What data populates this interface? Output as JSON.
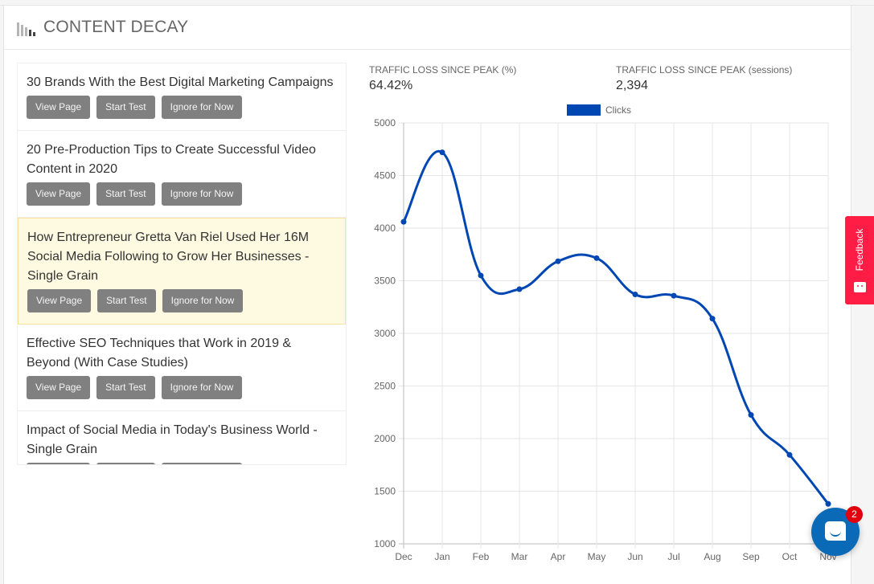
{
  "panel": {
    "title": "CONTENT DECAY",
    "icon": "bar-chart-decreasing-icon"
  },
  "list": {
    "items": [
      {
        "title": "30 Brands With the Best Digital Marketing Campaigns",
        "highlighted": false
      },
      {
        "title": "20 Pre-Production Tips to Create Successful Video Content in 2020",
        "highlighted": false
      },
      {
        "title": "How Entrepreneur Gretta Van Riel Used Her 16M Social Media Following to Grow Her Businesses - Single Grain",
        "highlighted": true
      },
      {
        "title": "Effective SEO Techniques that Work in 2019 & Beyond (With Case Studies)",
        "highlighted": false
      },
      {
        "title": "Impact of Social Media in Today's Business World - Single Grain",
        "highlighted": false
      }
    ],
    "buttons": {
      "view": "View Page",
      "test": "Start Test",
      "ignore": "Ignore for Now"
    }
  },
  "stats": {
    "loss_pct_label": "TRAFFIC LOSS SINCE PEAK (%)",
    "loss_pct_value": "64.42%",
    "loss_sessions_label": "TRAFFIC LOSS SINCE PEAK (sessions)",
    "loss_sessions_value": "2,394"
  },
  "chart_data": {
    "type": "line",
    "title": "",
    "xlabel": "",
    "ylabel": "",
    "categories": [
      "Dec",
      "Jan",
      "Feb",
      "Mar",
      "Apr",
      "May",
      "Jun",
      "Jul",
      "Aug",
      "Sep",
      "Oct",
      "Nov"
    ],
    "series": [
      {
        "name": "Clicks",
        "color": "#0047b3",
        "values": [
          4060,
          4720,
          3550,
          3420,
          3685,
          3715,
          3370,
          3358,
          3140,
          2225,
          1845,
          1380
        ]
      }
    ],
    "ylim": [
      1000,
      5000
    ],
    "yticks": [
      1000,
      1500,
      2000,
      2500,
      3000,
      3500,
      4000,
      4500,
      5000
    ],
    "grid": true,
    "legend": "top-center",
    "smooth": true
  },
  "feedback": {
    "label": "Feedback",
    "color": "#ff1d46"
  },
  "chat": {
    "badge_count": "2",
    "color": "#0a6ab8"
  }
}
